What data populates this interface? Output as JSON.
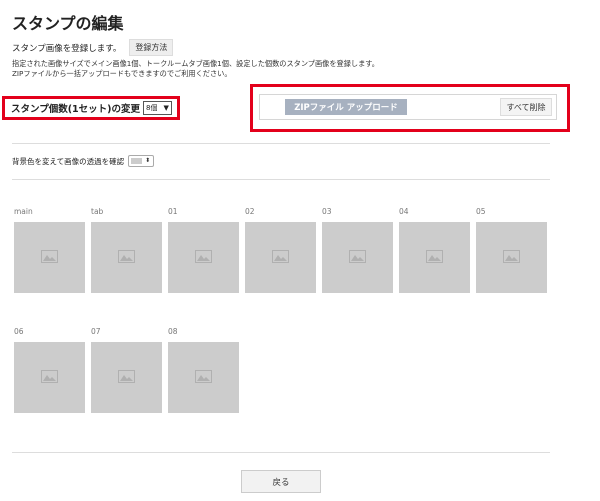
{
  "page": {
    "title": "スタンプの編集"
  },
  "intro": {
    "text": "スタンプ画像を登録します。",
    "howto_button": "登録方法"
  },
  "description": {
    "line1": "指定された画像サイズでメイン画像1個、トークルームタブ画像1個、設定した個数のスタンプ画像を登録します。",
    "line2": "ZIPファイルから一括アップロードもできますのでご利用ください。"
  },
  "count": {
    "label": "スタンプ個数(1セット)の変更",
    "selected": "8個"
  },
  "upload": {
    "zip_button": "ZIPファイル アップロード",
    "delete_all_button": "すべて削除"
  },
  "background": {
    "label": "背景色を変えて画像の透過を確認",
    "swatch_color": "#cccccc"
  },
  "slots": {
    "row1": [
      {
        "label": "main"
      },
      {
        "label": "tab"
      },
      {
        "label": "01"
      },
      {
        "label": "02"
      },
      {
        "label": "03"
      },
      {
        "label": "04"
      },
      {
        "label": "05"
      }
    ],
    "row2": [
      {
        "label": "06"
      },
      {
        "label": "07"
      },
      {
        "label": "08"
      }
    ]
  },
  "footer": {
    "back_button": "戻る"
  },
  "colors": {
    "highlight_border": "#e3001b",
    "zip_button_bg": "#a7b1c0",
    "tile_bg": "#cccccc",
    "placeholder_icon": "#b0b0b0"
  }
}
